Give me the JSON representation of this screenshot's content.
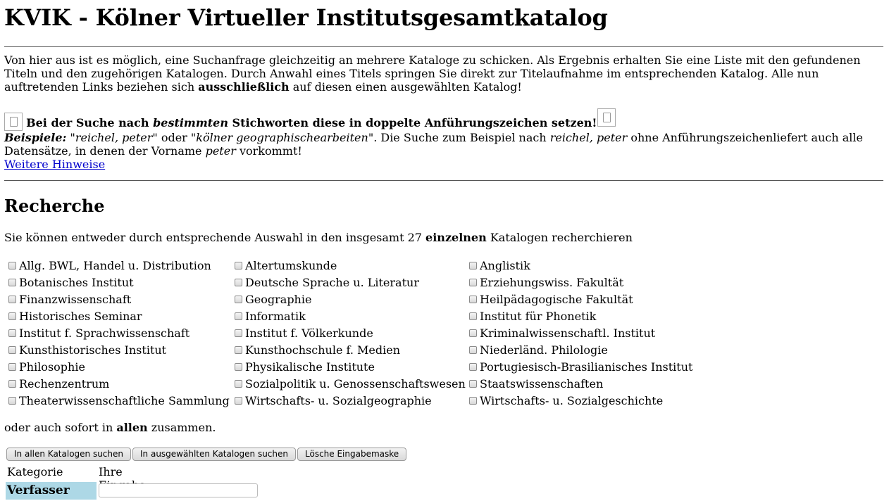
{
  "page": {
    "title": "KVIK - Kölner Virtueller Institutsgesamtkatalog",
    "intro": {
      "text1": "Von hier aus ist es möglich, eine Suchanfrage gleichzeitig an mehrere Kataloge zu schicken. Als Ergebnis erhalten Sie eine Liste mit den gefundenen Titeln und den zugehörigen Katalogen. Durch Anwahl eines Titels springen Sie direkt zur Titelaufnahme im entsprechenden Katalog. Alle nun auftretenden Links beziehen sich ",
      "bold": "ausschließlich",
      "text2": " auf diesen einen ausgewählten Katalog!"
    },
    "warning": {
      "part1": "Bei der Suche nach ",
      "italic": "bestimmten",
      "part2": " Stichworten diese in doppelte Anführungszeichen setzen!"
    },
    "examples": {
      "label": "Beispiele:",
      "q1": "\"",
      "ex1": "reichel, peter",
      "mid": "\" oder \"",
      "ex2": "kölner geographischearbeiten",
      "tail1": "\". Die Suche zum Beispiel nach ",
      "ex3": "reichel, peter",
      "tail2": " ohne Anführungszeichenliefert auch alle Datensätze, in denen der Vorname ",
      "ex4": "peter",
      "tail3": " vorkommt!"
    },
    "more_link": "Weitere Hinweise"
  },
  "recherche": {
    "heading": "Recherche",
    "p1_a": "Sie können entweder durch entsprechende Auswahl in den insgesamt 27 ",
    "p1_bold": "einzelnen",
    "p1_b": " Katalogen recherchieren",
    "columns": [
      [
        "Allg. BWL, Handel u. Distribution",
        "Botanisches Institut",
        "Finanzwissenschaft",
        "Historisches Seminar",
        "Institut f. Sprachwissenschaft",
        "Kunsthistorisches Institut",
        "Philosophie",
        "Rechenzentrum",
        "Theaterwissenschaftliche Sammlung"
      ],
      [
        "Altertumskunde",
        "Deutsche Sprache u. Literatur",
        "Geographie",
        "Informatik",
        "Institut f. Völkerkunde",
        "Kunsthochschule f. Medien",
        "Physikalische Institute",
        "Sozialpolitik u. Genossenschaftswesen",
        "Wirtschafts- u. Sozialgeographie"
      ],
      [
        "Anglistik",
        "Erziehungswiss. Fakultät",
        "Heilpädagogische Fakultät",
        "Institut für Phonetik",
        "Kriminalwissenschaftl. Institut",
        "Niederländ. Philologie",
        "Portugiesisch-Brasilianisches Institut",
        "Staatswissenschaften",
        "Wirtschafts- u. Sozialgeschichte"
      ]
    ],
    "p2_a": "oder auch sofort in ",
    "p2_bold": "allen",
    "p2_b": " zusammen."
  },
  "buttons": {
    "all": "In allen Katalogen suchen",
    "selected": "In ausgewählten Katalogen suchen",
    "clear": "Lösche Eingabemaske"
  },
  "form": {
    "col_category": "Kategorie",
    "col_input": "Ihre Eingabe",
    "field_author": "Verfasser",
    "field_author_value": ""
  },
  "colors": {
    "label_bg": "#add8e6",
    "link": "#0000cc"
  }
}
